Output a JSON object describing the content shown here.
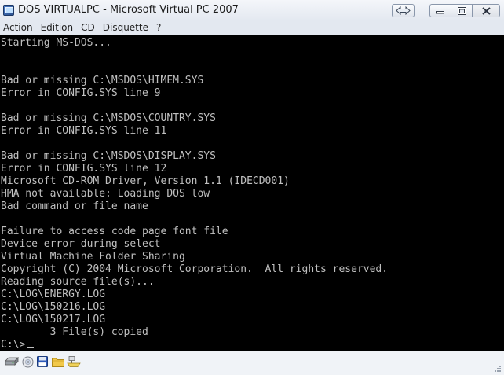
{
  "window": {
    "title": "DOS VIRTUALPC - Microsoft Virtual PC 2007"
  },
  "menu": [
    {
      "label": "Action"
    },
    {
      "label": "Edition"
    },
    {
      "label": "CD"
    },
    {
      "label": "Disquette"
    },
    {
      "label": "?"
    }
  ],
  "console": {
    "lines": [
      "Starting MS-DOS...",
      "",
      "",
      "Bad or missing C:\\MSDOS\\HIMEM.SYS",
      "Error in CONFIG.SYS line 9",
      "",
      "Bad or missing C:\\MSDOS\\COUNTRY.SYS",
      "Error in CONFIG.SYS line 11",
      "",
      "Bad or missing C:\\MSDOS\\DISPLAY.SYS",
      "Error in CONFIG.SYS line 12",
      "Microsoft CD-ROM Driver, Version 1.1 (IDECD001)",
      "HMA not available: Loading DOS low",
      "Bad command or file name",
      "",
      "Failure to access code page font file",
      "Device error during select",
      "Virtual Machine Folder Sharing",
      "Copyright (C) 2004 Microsoft Corporation.  All rights reserved.",
      "Reading source file(s)...",
      "C:\\LOG\\ENERGY.LOG",
      "C:\\LOG\\150216.LOG",
      "C:\\LOG\\150217.LOG",
      "        3 File(s) copied",
      "C:\\>"
    ]
  },
  "statusbar": {
    "icons": [
      "hard-disk-icon",
      "cd-drive-icon",
      "floppy-disk-icon",
      "shared-folder-icon",
      "network-icon"
    ]
  },
  "colors": {
    "console_bg": "#000000",
    "console_text": "#c0c0c0",
    "chrome_bg": "#e3e8f0"
  }
}
